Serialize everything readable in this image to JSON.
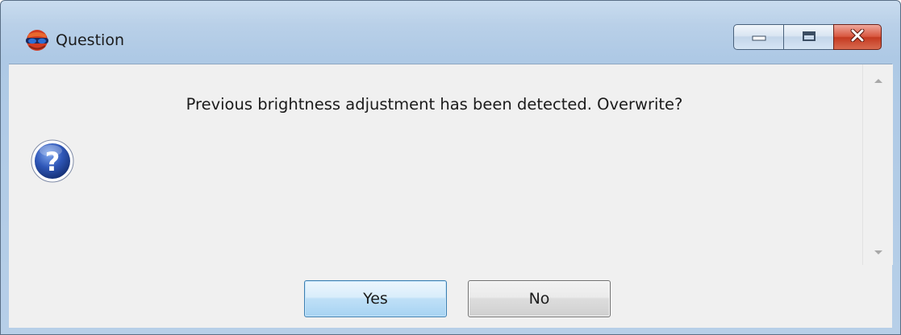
{
  "window": {
    "title": "Question",
    "app_icon": "3d-glasses-globe-icon",
    "controls": [
      "minimize-icon",
      "maximize-icon",
      "close-icon"
    ]
  },
  "dialog": {
    "icon": "question-mark-icon",
    "message": "Previous brightness adjustment has been detected. Overwrite?",
    "buttons": {
      "yes_label": "Yes",
      "no_label": "No"
    }
  },
  "colors": {
    "close_button": "#c43a21",
    "question_icon": "#2f57b8",
    "default_button_border": "#3c7fb1"
  }
}
